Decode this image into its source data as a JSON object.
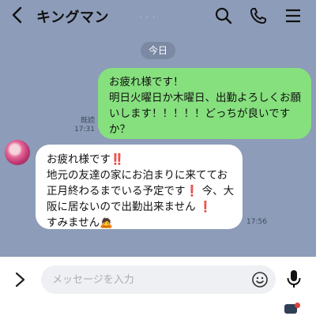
{
  "header": {
    "back_icon": "chevron-left-icon",
    "title": "キングマン",
    "icons": [
      "search-icon",
      "phone-icon",
      "menu-icon"
    ]
  },
  "date_separator": "今日",
  "messages": [
    {
      "direction": "outgoing",
      "text": "お疲れ様です！\n明日火曜日か木曜日、出勤よろしくお願いします！！！！！どっちが良いですか？",
      "read_label": "既読",
      "time": "17:31",
      "bubble_color": "#86e07e"
    },
    {
      "direction": "incoming",
      "text": "お疲れ様です‼️\n地元の友達の家にお泊まりに来ててお正月終わるまでいる予定です❗️ 今、大阪に居ないので出勤出来ません ❗️\nすみません🙇",
      "time": "17:56",
      "avatar_icon": "avatar-image",
      "bubble_color": "#ffffff"
    }
  ],
  "composer": {
    "expand_icon": "chevron-right-icon",
    "placeholder": "メッセージを入力",
    "emoji_icon": "emoji-smiley-icon",
    "mic_icon": "microphone-icon"
  },
  "colors": {
    "chat_background": "#8d9cb8",
    "outgoing_bubble": "#86e07e",
    "incoming_bubble": "#ffffff"
  }
}
